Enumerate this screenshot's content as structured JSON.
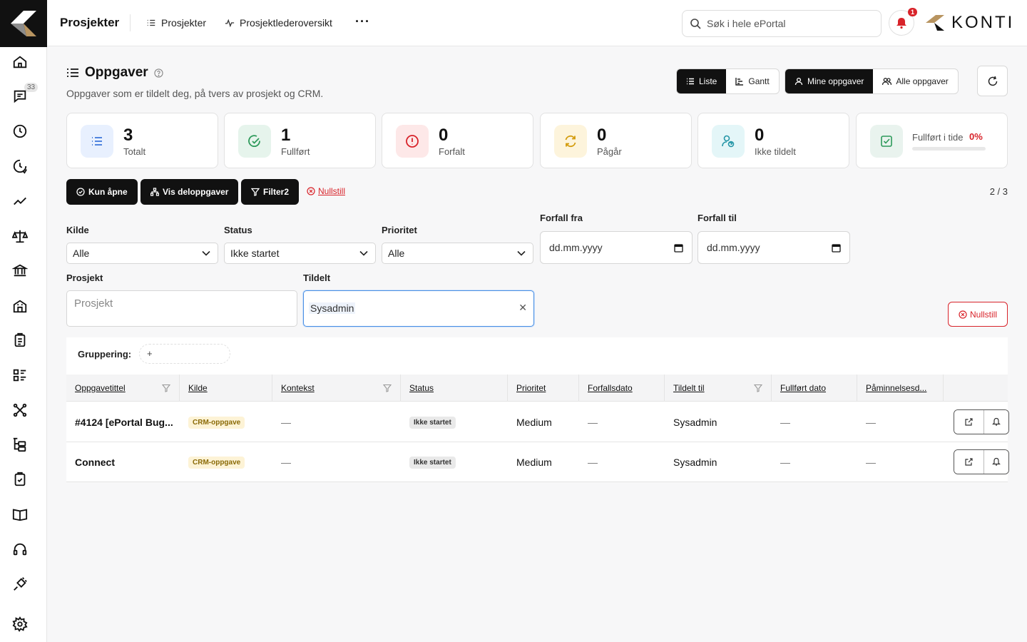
{
  "sidebar": {
    "badge": "33"
  },
  "topbar": {
    "app_title": "Prosjekter",
    "nav": [
      {
        "label": "Prosjekter"
      },
      {
        "label": "Prosjektlederoversikt"
      }
    ],
    "more_label": "···",
    "search_placeholder": "Søk i hele ePortal",
    "notification_count": "1",
    "brand": "KONTI"
  },
  "page": {
    "title": "Oppgaver",
    "subtitle": "Oppgaver som er tildelt deg, på tvers av prosjekt og CRM.",
    "view_options": [
      "Liste",
      "Gantt"
    ],
    "scope_options": [
      "Mine oppgaver",
      "Alle oppgaver"
    ]
  },
  "kpis": [
    {
      "value": "3",
      "label": "Totalt",
      "bg": "#e8f0fe",
      "fg": "#3b74d9"
    },
    {
      "value": "1",
      "label": "Fullført",
      "bg": "#e6f4ec",
      "fg": "#2e9a5b"
    },
    {
      "value": "0",
      "label": "Forfalt",
      "bg": "#fde8e8",
      "fg": "#d8232a"
    },
    {
      "value": "0",
      "label": "Pågår",
      "bg": "#fdf4dc",
      "fg": "#d39b0b"
    },
    {
      "value": "0",
      "label": "Ikke tildelt",
      "bg": "#e4f6f8",
      "fg": "#2596a7"
    }
  ],
  "progress": {
    "label": "Fullført i tide",
    "value_text": "0%",
    "fraction": 0,
    "bg": "#e9f3ee",
    "fg": "#2e9a5b"
  },
  "filters": {
    "buttons": [
      "Kun åpne",
      "Vis deloppgaver",
      "Filter2"
    ],
    "reset_link": "Nullstill",
    "pager": "2 / 3",
    "kilde": {
      "label": "Kilde",
      "value": "Alle"
    },
    "status": {
      "label": "Status",
      "value": "Ikke startet"
    },
    "prioritet": {
      "label": "Prioritet",
      "value": "Alle"
    },
    "forfall_fra": {
      "label": "Forfall fra",
      "value": "dd.mm.yyyy"
    },
    "forfall_til": {
      "label": "Forfall til",
      "value": "dd.mm.yyyy"
    },
    "prosjekt": {
      "label": "Prosjekt",
      "placeholder": "Prosjekt"
    },
    "tildelt": {
      "label": "Tildelt",
      "value": "Sysadmin"
    },
    "reset_button": "Nullstill"
  },
  "table": {
    "grouping_label": "Gruppering:",
    "grouping_add": "+",
    "columns": [
      "Oppgavetittel",
      "Kilde",
      "Kontekst",
      "Status",
      "Prioritet",
      "Forfallsdato",
      "Tildelt til",
      "Fullført dato",
      "Påminnelsesd..."
    ],
    "rows": [
      {
        "title": "#4124 [ePortal Bug...",
        "kilde": "CRM-oppgave",
        "kontekst": "—",
        "status": "Ikke startet",
        "prioritet": "Medium",
        "forfall": "—",
        "tildelt": "Sysadmin",
        "fullfort": "—",
        "paminnelse": "—"
      },
      {
        "title": "Connect",
        "kilde": "CRM-oppgave",
        "kontekst": "—",
        "status": "Ikke startet",
        "prioritet": "Medium",
        "forfall": "—",
        "tildelt": "Sysadmin",
        "fullfort": "—",
        "paminnelse": "—"
      }
    ]
  },
  "colors": {
    "accent": "#d8232a",
    "dark": "#111111",
    "brand_gold": "#b89460"
  }
}
